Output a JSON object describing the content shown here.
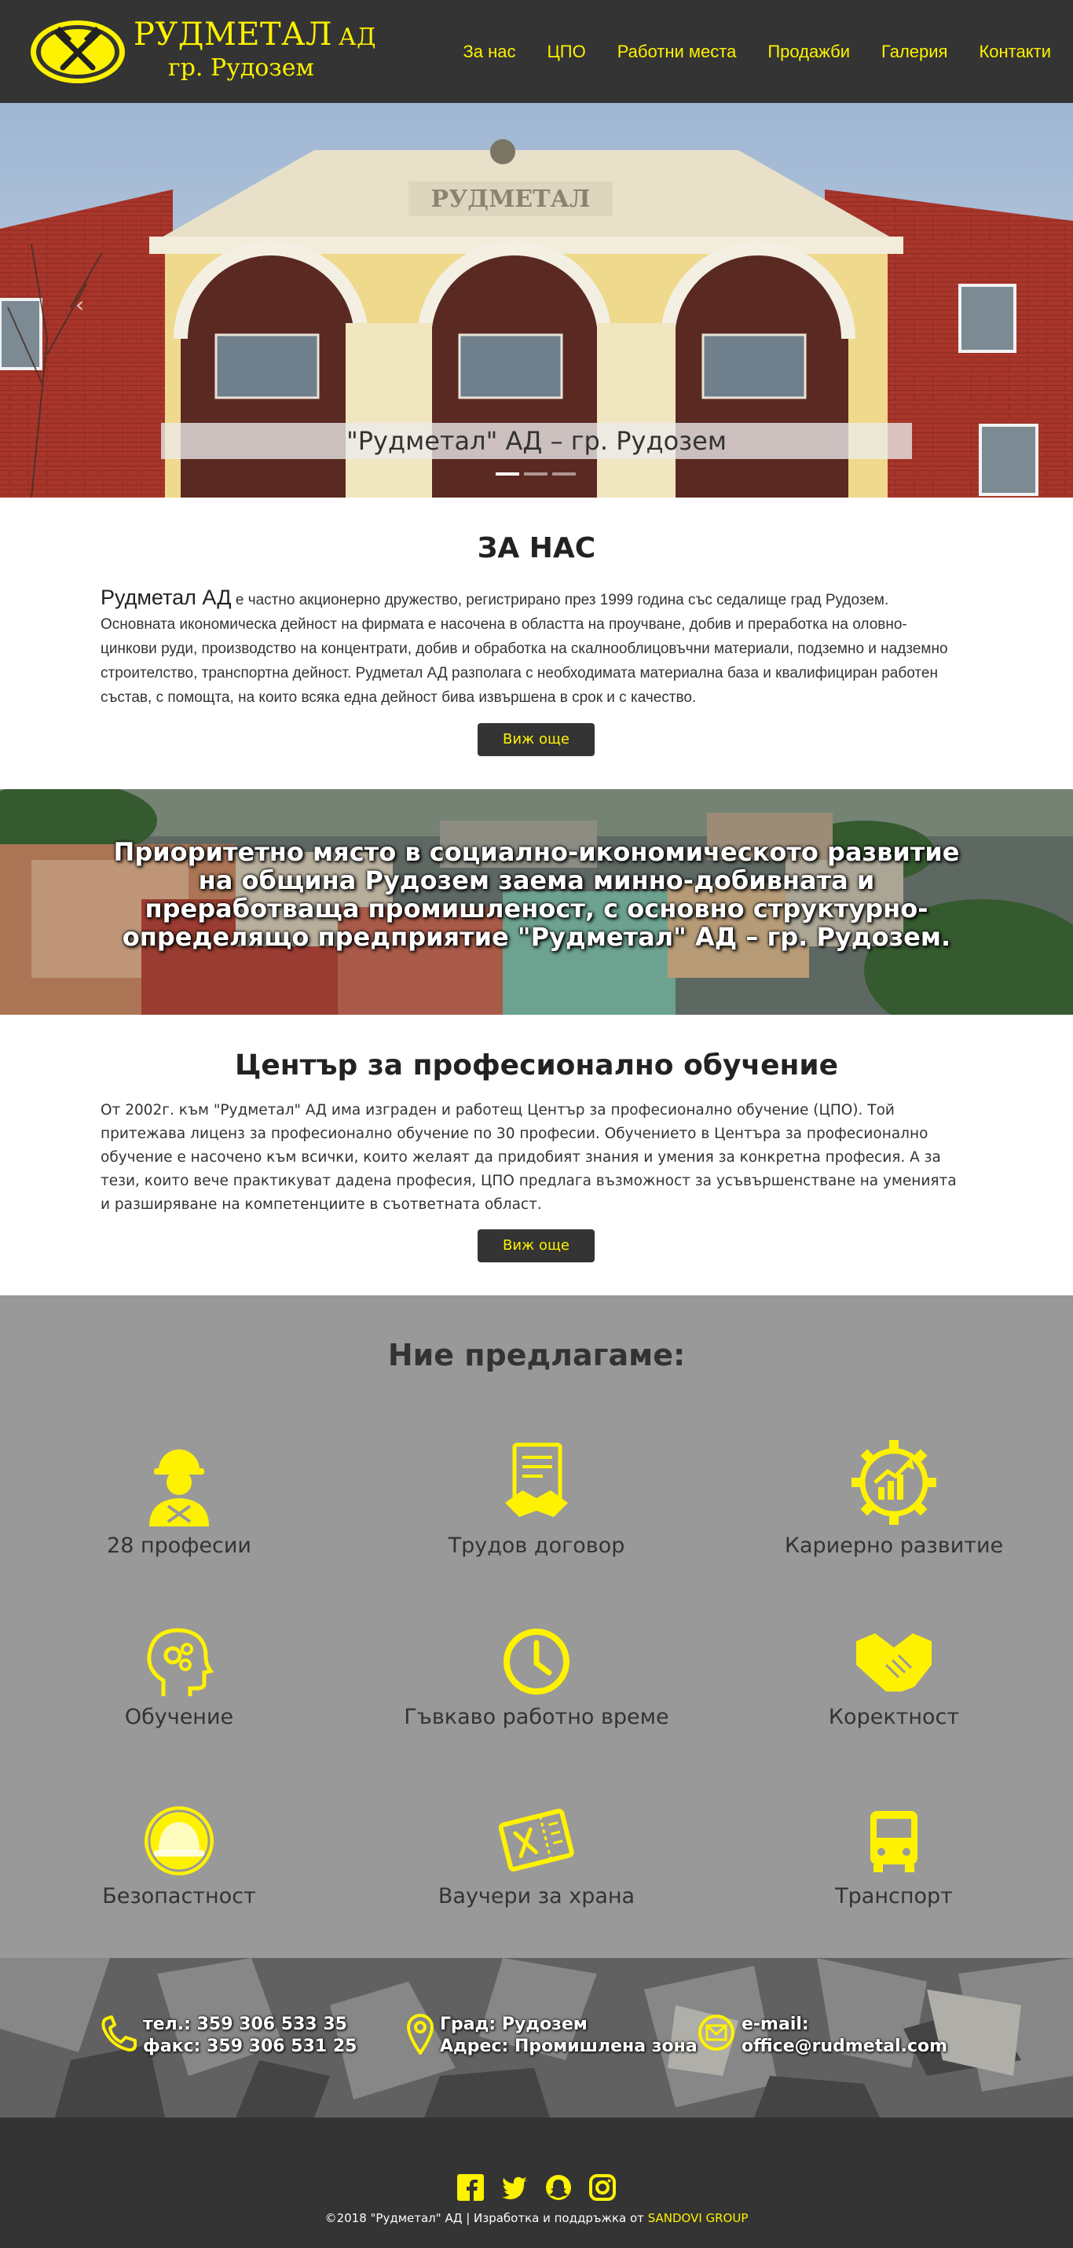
{
  "header": {
    "brand_name": "РУДМЕТАЛ",
    "brand_suffix": "АД",
    "brand_city": "гр. Рудозем",
    "nav": [
      "За нас",
      "ЦПО",
      "Работни места",
      "Продажби",
      "Галерия",
      "Контакти"
    ]
  },
  "hero": {
    "building_sign": "РУДМЕТАЛ",
    "caption": "\"Рудметал\" АД – гр. Рудозем",
    "slides_count": 3,
    "active_slide": 1,
    "prev_arrow": "‹"
  },
  "about": {
    "title": "ЗА НАС",
    "lead": "Рудметал АД",
    "text": " е частно акционерно дружество, регистрирано през 1999 година със седалище град Рудозем. Основната икономическа дейност на фирмата е насочена в областта на проучване, добив и преработка на оловно-цинкови руди, производство на концентрати, добив и обработка на скалнооблицовъчни материали, подземно и надземно строителство, транспортна дейност. Рудметал АД разполага с необходимата материална база и квалифициран работен състав, с помощта, на които всяка една дейност бива извършена в срок и с качество.",
    "button": "Виж още"
  },
  "banner": {
    "text": "Приоритетно място в социално-икономическото развитие на община Рудозем заема минно-добивната и преработваща промишленост, с основно структурно-определящо предприятие \"Рудметал\" АД – гр. Рудозем."
  },
  "cpo": {
    "title": "Център за професионално обучение",
    "text": "От 2002г. към \"Рудметал\" АД има изграден и работещ Център за професионално обучение (ЦПО). Той притежава лиценз за професионално обучение по 30 професии. Обучението в Центъра за професионално обучение е насочено към всички, които желаят да придобият знания и умения за конкретна професия. А за тези, които вече практикуват дадена професия, ЦПО предлага възможност за усъвършенстване на уменията и разширяване на компетенциите в съответната област.",
    "button": "Виж още"
  },
  "offer": {
    "title": "Ние предлагаме:",
    "items": [
      {
        "label": "28 професии",
        "icon": "worker-icon"
      },
      {
        "label": "Трудов договор",
        "icon": "contract-handshake-icon"
      },
      {
        "label": "Кариерно развитие",
        "icon": "career-gear-chart-icon"
      },
      {
        "label": "Обучение",
        "icon": "head-gears-icon"
      },
      {
        "label": "Гъвкаво работно време",
        "icon": "clock-icon"
      },
      {
        "label": "Коректност",
        "icon": "handshake-icon"
      },
      {
        "label": "Безопастност",
        "icon": "helmet-icon"
      },
      {
        "label": "Ваучери за храна",
        "icon": "food-voucher-icon"
      },
      {
        "label": "Транспорт",
        "icon": "bus-icon"
      }
    ],
    "accent_color": "#fff200"
  },
  "contact": {
    "phone": "тел.: 359 306 533 35",
    "fax": "факс: 359 306 531 25",
    "city": "Град: Рудозем",
    "address": "Адрес: Промишлена зона",
    "email_label": "e-mail:",
    "email": "office@rudmetal.com"
  },
  "footer": {
    "social": [
      "facebook-icon",
      "twitter-icon",
      "snapchat-icon",
      "instagram-icon"
    ],
    "copyright": "©2018 \"Рудметал\" АД | Изработка и поддръжка от ",
    "developer": "SANDOVI GROUP"
  },
  "colors": {
    "accent": "#fff200",
    "dark": "#343434",
    "offer_bg": "#999999"
  }
}
